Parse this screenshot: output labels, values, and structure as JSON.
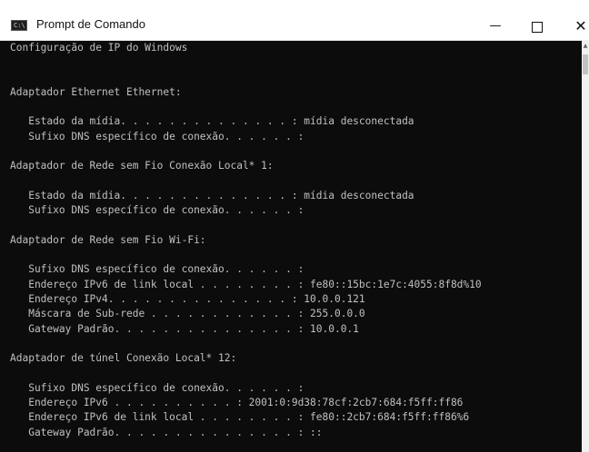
{
  "window": {
    "title": "Prompt de Comando",
    "app_icon": "cmd-icon",
    "controls": {
      "minimize_icon": "minimize-icon",
      "maximize_icon": "maximize-icon",
      "close_icon": "close-icon",
      "minimize_glyph": "—",
      "close_glyph": "✕"
    }
  },
  "console": {
    "background": "#0c0c0c",
    "foreground": "#c0c0c0",
    "lines": [
      "Configuração de IP do Windows",
      "",
      "",
      "Adaptador Ethernet Ethernet:",
      "",
      "   Estado da mídia. . . . . . . . . . . . . . : mídia desconectada",
      "   Sufixo DNS específico de conexão. . . . . . :",
      "",
      "Adaptador de Rede sem Fio Conexão Local* 1:",
      "",
      "   Estado da mídia. . . . . . . . . . . . . . : mídia desconectada",
      "   Sufixo DNS específico de conexão. . . . . . :",
      "",
      "Adaptador de Rede sem Fio Wi-Fi:",
      "",
      "   Sufixo DNS específico de conexão. . . . . . :",
      "   Endereço IPv6 de link local . . . . . . . . : fe80::15bc:1e7c:4055:8f8d%10",
      "   Endereço IPv4. . . . . . . . . . . . . . . : 10.0.0.121",
      "   Máscara de Sub-rede . . . . . . . . . . . . : 255.0.0.0",
      "   Gateway Padrão. . . . . . . . . . . . . . . : 10.0.0.1",
      "",
      "Adaptador de túnel Conexão Local* 12:",
      "",
      "   Sufixo DNS específico de conexão. . . . . . :",
      "   Endereço IPv6 . . . . . . . . . . : 2001:0:9d38:78cf:2cb7:684:f5ff:ff86",
      "   Endereço IPv6 de link local . . . . . . . . : fe80::2cb7:684:f5ff:ff86%6",
      "   Gateway Padrão. . . . . . . . . . . . . . . : ::"
    ]
  }
}
